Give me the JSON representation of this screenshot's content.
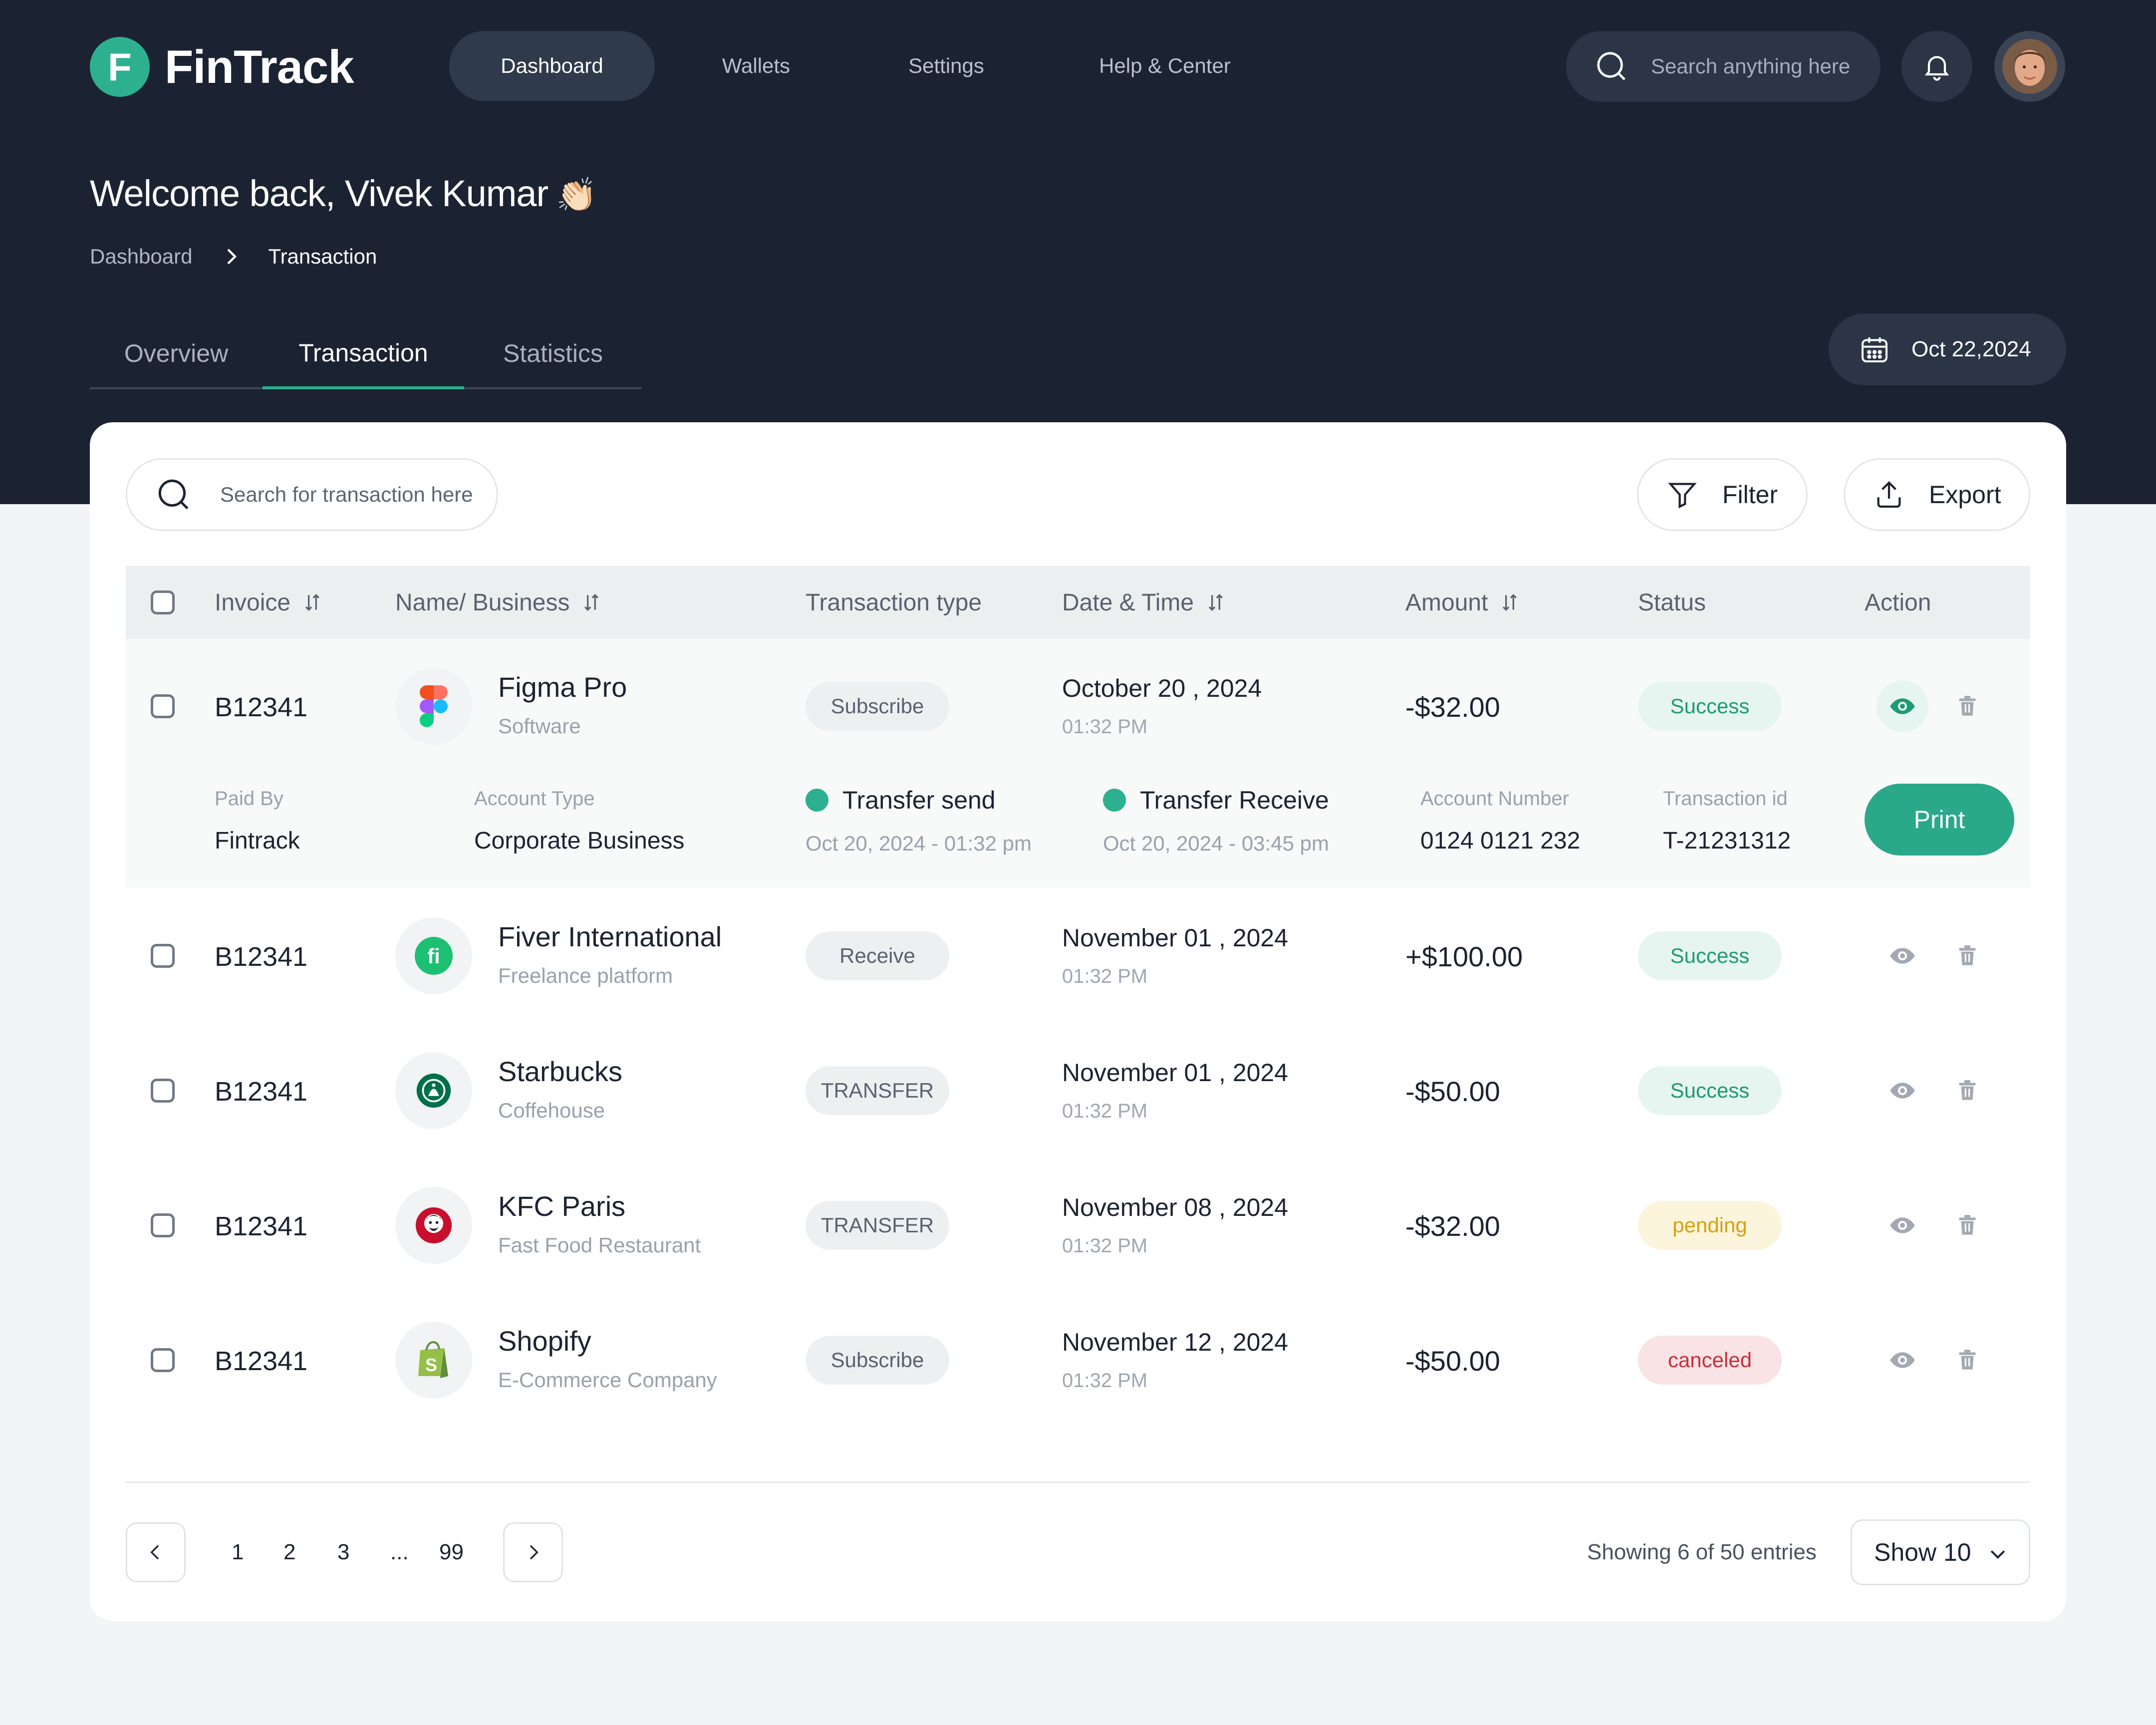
{
  "app": {
    "logo_letter": "F",
    "name": "FinTrack"
  },
  "nav": {
    "items": [
      "Dashboard",
      "Wallets",
      "Settings",
      "Help & Center"
    ]
  },
  "top_search": {
    "placeholder": "Search anything here"
  },
  "welcome": {
    "text": "Welcome back, Vivek Kumar",
    "emoji": "👏🏻"
  },
  "breadcrumb": {
    "root": "Dashboard",
    "current": "Transaction"
  },
  "tabs": [
    "Overview",
    "Transaction",
    "Statistics"
  ],
  "date": "Oct 22,2024",
  "tx_search": {
    "placeholder": "Search for transaction here"
  },
  "toolbar": {
    "filter": "Filter",
    "export": "Export"
  },
  "table": {
    "headers": {
      "invoice": "Invoice",
      "name": "Name/ Business",
      "type": "Transaction type",
      "datetime": "Date & Time",
      "amount": "Amount",
      "status": "Status",
      "action": "Action"
    },
    "rows": [
      {
        "invoice": "B12341",
        "name": "Figma Pro",
        "sub": "Software",
        "type": "Subscribe",
        "date": "October 20 , 2024",
        "time": "01:32 PM",
        "amount": "-$32.00",
        "status": "Success",
        "icon": "figma-logo-icon"
      },
      {
        "invoice": "B12341",
        "name": "Fiver International",
        "sub": "Freelance platform",
        "type": "Receive",
        "date": "November 01 , 2024",
        "time": "01:32 PM",
        "amount": "+$100.00",
        "status": "Success",
        "icon": "fiverr-logo-icon"
      },
      {
        "invoice": "B12341",
        "name": "Starbucks",
        "sub": "Coffehouse",
        "type": "TRANSFER",
        "date": "November 01 , 2024",
        "time": "01:32 PM",
        "amount": "-$50.00",
        "status": "Success",
        "icon": "starbucks-logo-icon"
      },
      {
        "invoice": "B12341",
        "name": "KFC Paris",
        "sub": "Fast Food Restaurant",
        "type": "TRANSFER",
        "date": "November 08 , 2024",
        "time": "01:32 PM",
        "amount": "-$32.00",
        "status": "pending",
        "icon": "kfc-logo-icon"
      },
      {
        "invoice": "B12341",
        "name": "Shopify",
        "sub": "E-Commerce Company",
        "type": "Subscribe",
        "date": "November 12 , 2024",
        "time": "01:32 PM",
        "amount": "-$50.00",
        "status": "canceled",
        "icon": "shopify-logo-icon"
      }
    ]
  },
  "detail": {
    "paid_by_label": "Paid By",
    "paid_by": "Fintrack",
    "account_type_label": "Account Type",
    "account_type": "Corporate Business",
    "transfer_send": "Transfer send",
    "transfer_send_date": "Oct 20, 2024 - 01:32 pm",
    "transfer_receive": "Transfer Receive",
    "transfer_receive_date": "Oct 20, 2024 - 03:45 pm",
    "account_number_label": "Account Number",
    "account_number": "0124 0121 232",
    "transaction_id_label": "Transaction id",
    "transaction_id": "T-21231312",
    "print": "Print"
  },
  "pagination": {
    "pages": [
      "1",
      "2",
      "3",
      "...",
      "99"
    ],
    "showing": "Showing 6 of 50 entries",
    "show": "Show 10"
  },
  "colors": {
    "brand": "#2db08f",
    "header_bg": "#1b2333",
    "success": "#1f9a74",
    "pending": "#d6a113",
    "canceled": "#c62f3d"
  }
}
